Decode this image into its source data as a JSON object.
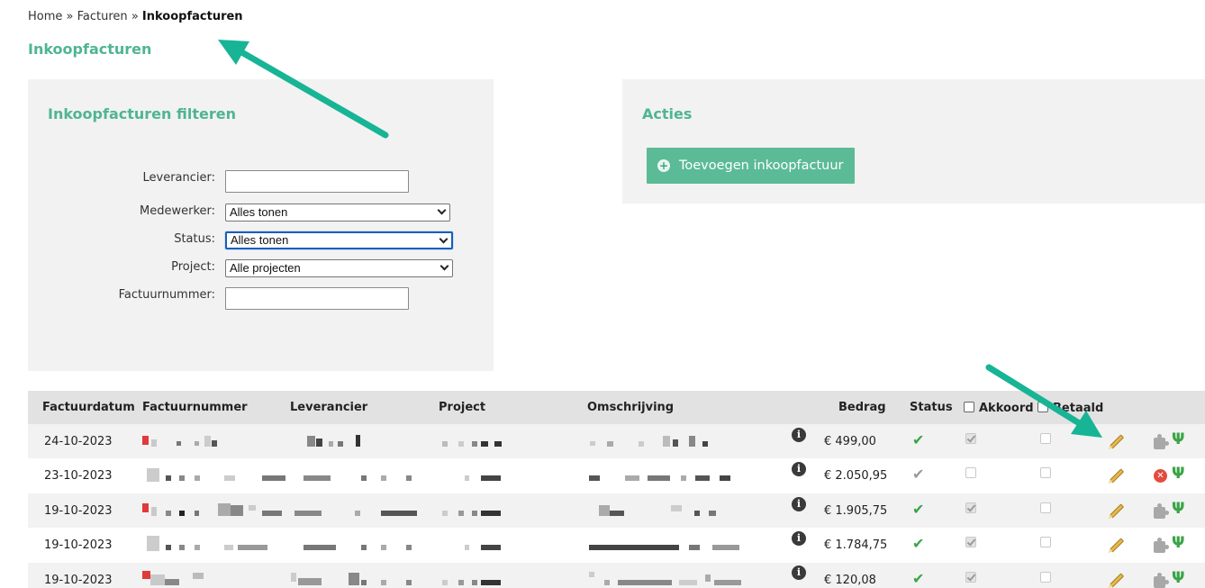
{
  "breadcrumb": {
    "home": "Home",
    "sep1": "»",
    "facturen": "Facturen",
    "sep2": "»",
    "current": "Inkoopfacturen"
  },
  "page_title": "Inkoopfacturen",
  "filter": {
    "title": "Inkoopfacturen filteren",
    "leverancier_label": "Leverancier:",
    "leverancier_value": "",
    "medewerker_label": "Medewerker:",
    "medewerker_value": "Alles tonen",
    "status_label": "Status:",
    "status_value": "Alles tonen",
    "project_label": "Project:",
    "project_value": "Alle projecten",
    "factuurnummer_label": "Factuurnummer:",
    "factuurnummer_value": ""
  },
  "actions": {
    "title": "Acties",
    "add_label": "Toevoegen inkoopfactuur",
    "add_icon": "plus-circle-icon"
  },
  "table": {
    "headers": {
      "factuurdatum": "Factuurdatum",
      "factuurnummer": "Factuurnummer",
      "leverancier": "Leverancier",
      "project": "Project",
      "omschrijving": "Omschrijving",
      "bedrag": "Bedrag",
      "status": "Status",
      "akkoord": "Akkoord",
      "betaald": "Betaald"
    },
    "rows": [
      {
        "date": "24-10-2023",
        "amount": "€ 499,00",
        "status": "approved",
        "akkoord": true,
        "betaald": false,
        "action": "puzzle"
      },
      {
        "date": "23-10-2023",
        "amount": "€ 2.050,95",
        "status": "pending",
        "akkoord": false,
        "betaald": false,
        "action": "delete"
      },
      {
        "date": "19-10-2023",
        "amount": "€ 1.905,75",
        "status": "approved",
        "akkoord": true,
        "betaald": false,
        "action": "puzzle"
      },
      {
        "date": "19-10-2023",
        "amount": "€ 1.784,75",
        "status": "approved",
        "akkoord": true,
        "betaald": false,
        "action": "puzzle"
      },
      {
        "date": "19-10-2023",
        "amount": "€ 120,08",
        "status": "approved",
        "akkoord": true,
        "betaald": false,
        "action": "puzzle"
      }
    ]
  },
  "colors": {
    "accent": "#4fb592",
    "button": "#5bbb96",
    "arrow": "#17b495",
    "check_green": "#3aa446",
    "check_grey": "#9a9a9a"
  }
}
